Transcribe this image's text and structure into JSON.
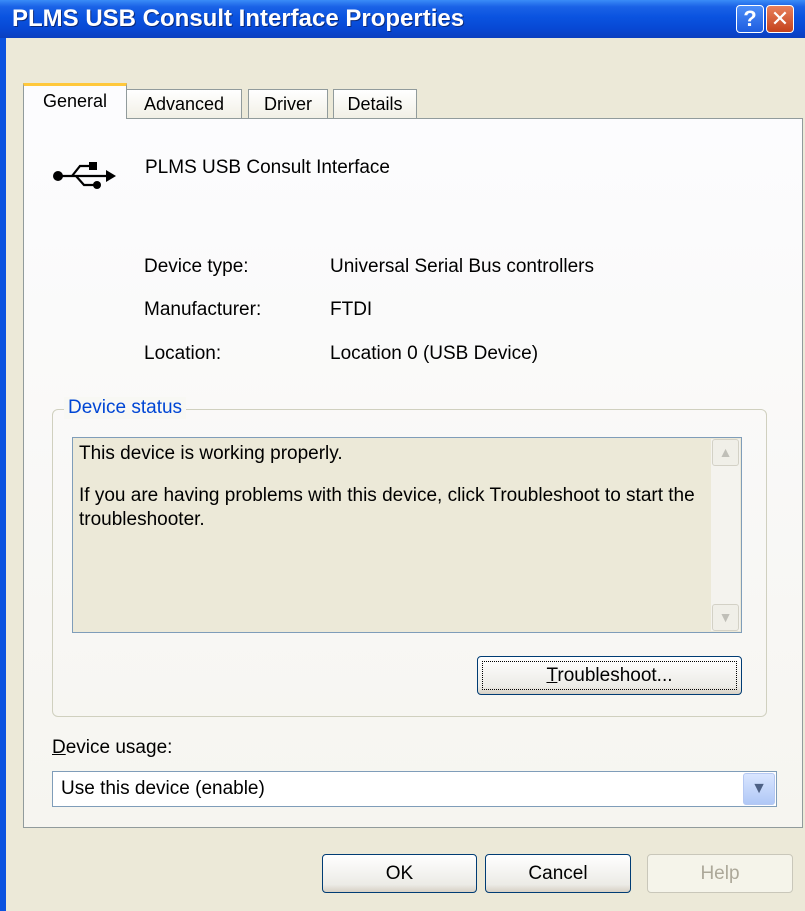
{
  "window": {
    "title": "PLMS USB Consult Interface Properties",
    "help_glyph": "?",
    "close_glyph": "✕"
  },
  "tabs": [
    {
      "label": "General",
      "active": true
    },
    {
      "label": "Advanced",
      "active": false
    },
    {
      "label": "Driver",
      "active": false
    },
    {
      "label": "Details",
      "active": false
    }
  ],
  "device": {
    "name": "PLMS USB Consult Interface",
    "icon": "usb-icon",
    "properties": [
      {
        "label": "Device type:",
        "value": "Universal Serial Bus controllers"
      },
      {
        "label": "Manufacturer:",
        "value": "FTDI"
      },
      {
        "label": "Location:",
        "value": "Location 0 (USB Device)"
      }
    ]
  },
  "status": {
    "group_label": "Device status",
    "line1": "This device is working properly.",
    "line2": "If you are having problems with this device, click Troubleshoot to start the troubleshooter.",
    "troubleshoot_label_rest": "roubleshoot...",
    "troubleshoot_label_mnemonic": "T"
  },
  "usage": {
    "label_mnemonic": "D",
    "label_rest": "evice usage:",
    "selected": "Use this device (enable)"
  },
  "buttons": {
    "ok": "OK",
    "cancel": "Cancel",
    "help": "Help"
  },
  "colors": {
    "titlebar": "#0a53e0",
    "face": "#ece9d8",
    "group_label": "#0046d5",
    "tab_highlight": "#ffc83c"
  }
}
